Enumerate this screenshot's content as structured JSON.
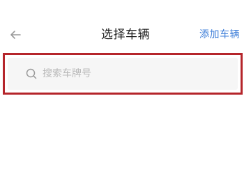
{
  "header": {
    "title": "选择车辆",
    "action_label": "添加车辆",
    "back_icon": "arrow-left-icon"
  },
  "search": {
    "placeholder": "搜索车牌号",
    "value": "",
    "icon": "search-icon"
  },
  "colors": {
    "accent": "#3f7fd9",
    "highlight_border": "#b5252b",
    "search_bg": "#f6f6f6",
    "placeholder": "#b9b9b9"
  }
}
